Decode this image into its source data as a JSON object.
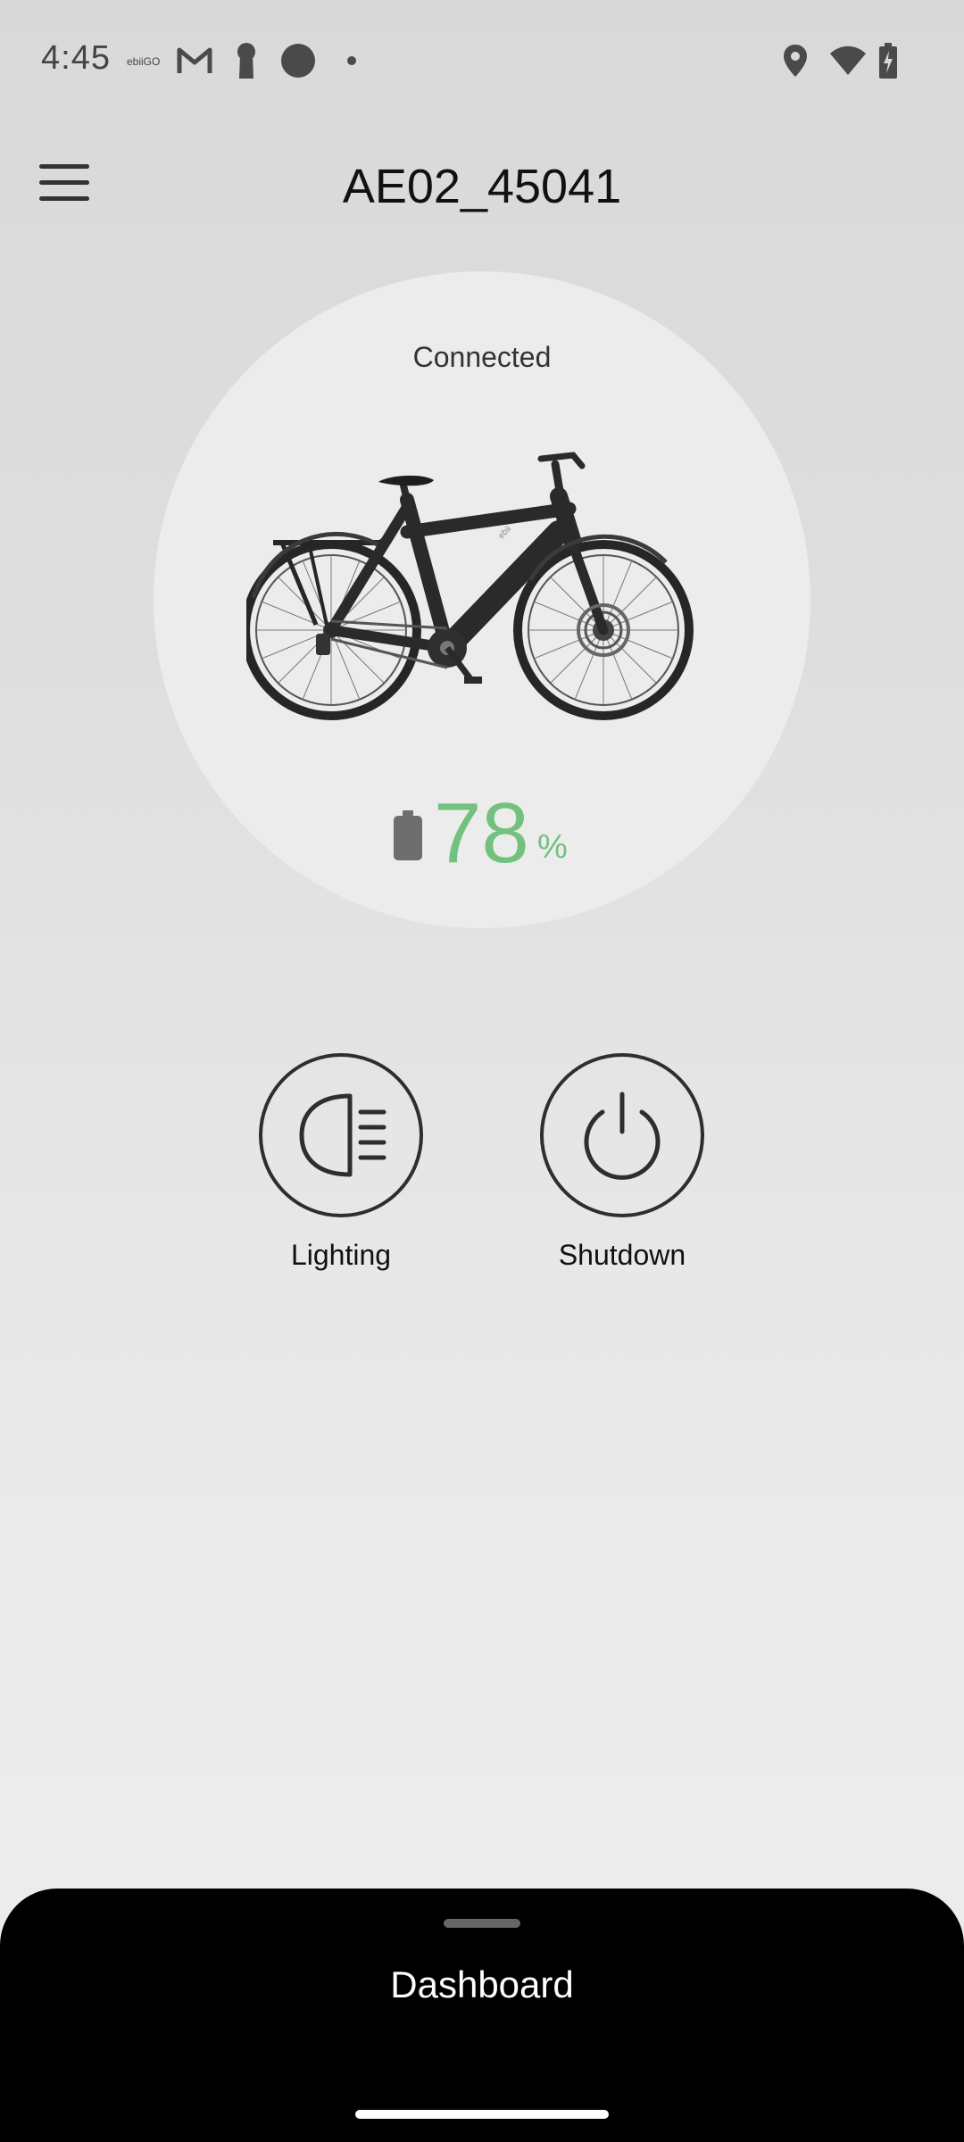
{
  "status_bar": {
    "time": "4:45",
    "app_label": "ebiiGO",
    "icons": [
      "gmail-icon",
      "keyhole-icon",
      "circle-notification-icon",
      "dot-icon",
      "location-icon",
      "wifi-icon",
      "battery-charging-icon"
    ]
  },
  "header": {
    "title": "AE02_45041",
    "menu_icon": "hamburger-menu-icon"
  },
  "device": {
    "connection_status": "Connected",
    "image": "bicycle-image",
    "battery_value": "78",
    "battery_unit": "%",
    "battery_color": "#72c17e"
  },
  "actions": [
    {
      "label": "Lighting",
      "icon": "headlight-icon"
    },
    {
      "label": "Shutdown",
      "icon": "power-icon"
    }
  ],
  "bottom_sheet": {
    "title": "Dashboard"
  },
  "colors": {
    "background_top": "#d9d9d9",
    "background_bottom": "#eeeeee",
    "circle": "#ececec",
    "accent_green": "#72c17e",
    "sheet": "#000000"
  }
}
